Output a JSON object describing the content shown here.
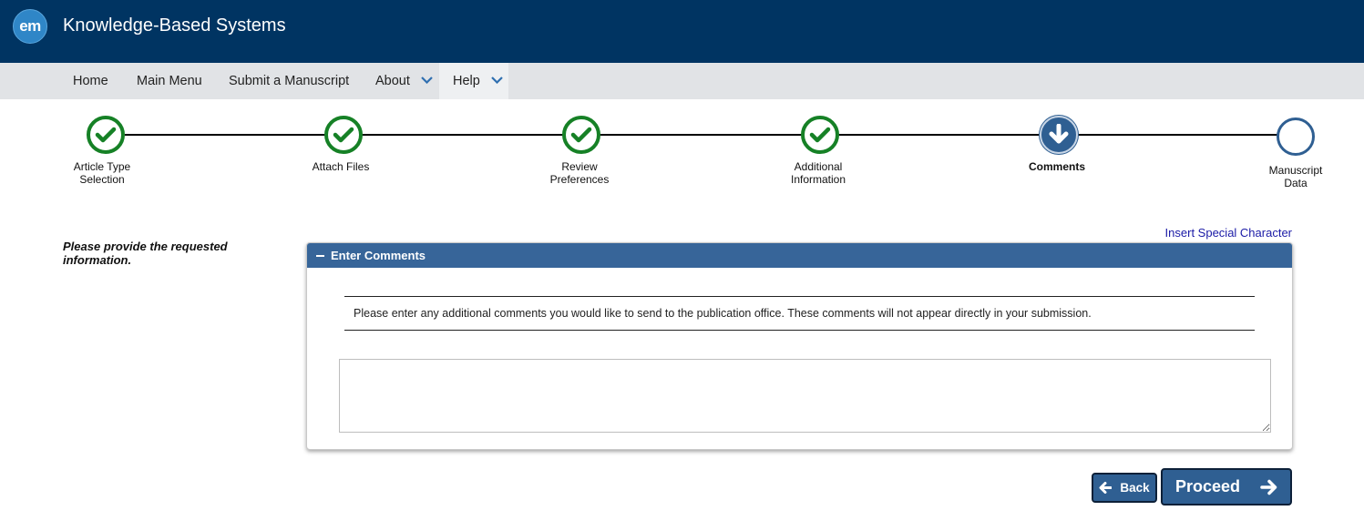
{
  "header": {
    "logo_text": "em",
    "title": "Knowledge-Based Systems"
  },
  "nav": {
    "items": [
      {
        "label": "Home"
      },
      {
        "label": "Main Menu"
      },
      {
        "label": "Submit a Manuscript"
      },
      {
        "label": "About"
      },
      {
        "label": "Help"
      }
    ]
  },
  "stepper": {
    "steps": [
      {
        "label_line1": "Article Type",
        "label_line2": "Selection",
        "status": "complete"
      },
      {
        "label_line1": "Attach Files",
        "label_line2": "",
        "status": "complete"
      },
      {
        "label_line1": "Review",
        "label_line2": "Preferences",
        "status": "complete"
      },
      {
        "label_line1": "Additional",
        "label_line2": "Information",
        "status": "complete"
      },
      {
        "label_line1": "Comments",
        "label_line2": "",
        "status": "current"
      },
      {
        "label_line1": "Manuscript",
        "label_line2": "Data",
        "status": "pending"
      }
    ],
    "complete_color": "#168126",
    "current_color": "#2f5f92"
  },
  "main": {
    "instruction": "Please provide the requested information.",
    "special_char_link": "Insert Special Character",
    "panel": {
      "title": "Enter Comments",
      "note": "Please enter any additional comments you would like to send to the publication office. These comments will not appear directly in your submission.",
      "comments_value": ""
    }
  },
  "buttons": {
    "back": "Back",
    "proceed": "Proceed"
  },
  "colors": {
    "header_bg": "#003462",
    "nav_bg": "#e1e3e6",
    "panel_header_bg": "#376599",
    "button_bg": "#2f5f92",
    "link": "#1a1aa6"
  }
}
